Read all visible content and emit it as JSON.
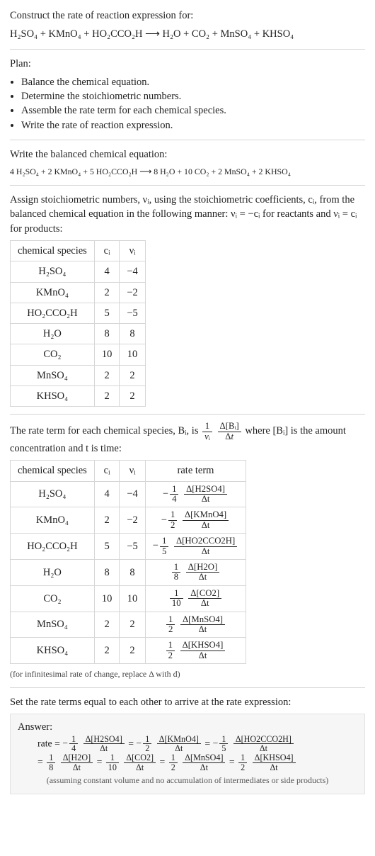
{
  "title": "Construct the rate of reaction expression for:",
  "unbalanced_eq": "H₂SO₄ + KMnO₄ + HO₂CCO₂H ⟶ H₂O + CO₂ + MnSO₄ + KHSO₄",
  "plan_heading": "Plan:",
  "plan_items": [
    "Balance the chemical equation.",
    "Determine the stoichiometric numbers.",
    "Assemble the rate term for each chemical species.",
    "Write the rate of reaction expression."
  ],
  "balanced_heading": "Write the balanced chemical equation:",
  "balanced_eq": "4 H₂SO₄ + 2 KMnO₄ + 5 HO₂CCO₂H ⟶ 8 H₂O + 10 CO₂ + 2 MnSO₄ + 2 KHSO₄",
  "stoich_text_a": "Assign stoichiometric numbers, νᵢ, using the stoichiometric coefficients, cᵢ, from the balanced chemical equation in the following manner: νᵢ = −cᵢ for reactants and νᵢ = cᵢ for products:",
  "table1": {
    "headers": [
      "chemical species",
      "cᵢ",
      "νᵢ"
    ],
    "rows": [
      [
        "H₂SO₄",
        "4",
        "−4"
      ],
      [
        "KMnO₄",
        "2",
        "−2"
      ],
      [
        "HO₂CCO₂H",
        "5",
        "−5"
      ],
      [
        "H₂O",
        "8",
        "8"
      ],
      [
        "CO₂",
        "10",
        "10"
      ],
      [
        "MnSO₄",
        "2",
        "2"
      ],
      [
        "KHSO₄",
        "2",
        "2"
      ]
    ]
  },
  "rate_term_text_a": "The rate term for each chemical species, Bᵢ, is",
  "rate_term_text_b": "where [Bᵢ] is the amount concentration and t is time:",
  "table2": {
    "headers": [
      "chemical species",
      "cᵢ",
      "νᵢ",
      "rate term"
    ],
    "rows": [
      {
        "sp": "H₂SO₄",
        "c": "4",
        "v": "−4",
        "coef": "−1/4",
        "d": "Δ[H2SO4]",
        "dt": "Δt"
      },
      {
        "sp": "KMnO₄",
        "c": "2",
        "v": "−2",
        "coef": "−1/2",
        "d": "Δ[KMnO4]",
        "dt": "Δt"
      },
      {
        "sp": "HO₂CCO₂H",
        "c": "5",
        "v": "−5",
        "coef": "−1/5",
        "d": "Δ[HO2CCO2H]",
        "dt": "Δt"
      },
      {
        "sp": "H₂O",
        "c": "8",
        "v": "8",
        "coef": "1/8",
        "d": "Δ[H2O]",
        "dt": "Δt"
      },
      {
        "sp": "CO₂",
        "c": "10",
        "v": "10",
        "coef": "1/10",
        "d": "Δ[CO2]",
        "dt": "Δt"
      },
      {
        "sp": "MnSO₄",
        "c": "2",
        "v": "2",
        "coef": "1/2",
        "d": "Δ[MnSO4]",
        "dt": "Δt"
      },
      {
        "sp": "KHSO₄",
        "c": "2",
        "v": "2",
        "coef": "1/2",
        "d": "Δ[KHSO4]",
        "dt": "Δt"
      }
    ]
  },
  "infinitesimal_note": "(for infinitesimal rate of change, replace Δ with d)",
  "set_equal_text": "Set the rate terms equal to each other to arrive at the rate expression:",
  "answer_label": "Answer:",
  "rate_label": "rate =",
  "answer_terms_top": [
    {
      "coef": "−1/4",
      "d": "Δ[H2SO4]",
      "dt": "Δt"
    },
    {
      "coef": "−1/2",
      "d": "Δ[KMnO4]",
      "dt": "Δt"
    },
    {
      "coef": "−1/5",
      "d": "Δ[HO2CCO2H]",
      "dt": "Δt"
    }
  ],
  "answer_terms_bot": [
    {
      "coef": "1/8",
      "d": "Δ[H2O]",
      "dt": "Δt"
    },
    {
      "coef": "1/10",
      "d": "Δ[CO2]",
      "dt": "Δt"
    },
    {
      "coef": "1/2",
      "d": "Δ[MnSO4]",
      "dt": "Δt"
    },
    {
      "coef": "1/2",
      "d": "Δ[KHSO4]",
      "dt": "Δt"
    }
  ],
  "assumption_note": "(assuming constant volume and no accumulation of intermediates or side products)",
  "chart_data": {
    "type": "table",
    "title": "Stoichiometric coefficients and rate terms for H2SO4 + KMnO4 + HO2CCO2H reaction",
    "species": [
      "H2SO4",
      "KMnO4",
      "HO2CCO2H",
      "H2O",
      "CO2",
      "MnSO4",
      "KHSO4"
    ],
    "c_i": [
      4,
      2,
      5,
      8,
      10,
      2,
      2
    ],
    "nu_i": [
      -4,
      -2,
      -5,
      8,
      10,
      2,
      2
    ],
    "rate_coefficients": [
      "-1/4",
      "-1/2",
      "-1/5",
      "1/8",
      "1/10",
      "1/2",
      "1/2"
    ]
  }
}
